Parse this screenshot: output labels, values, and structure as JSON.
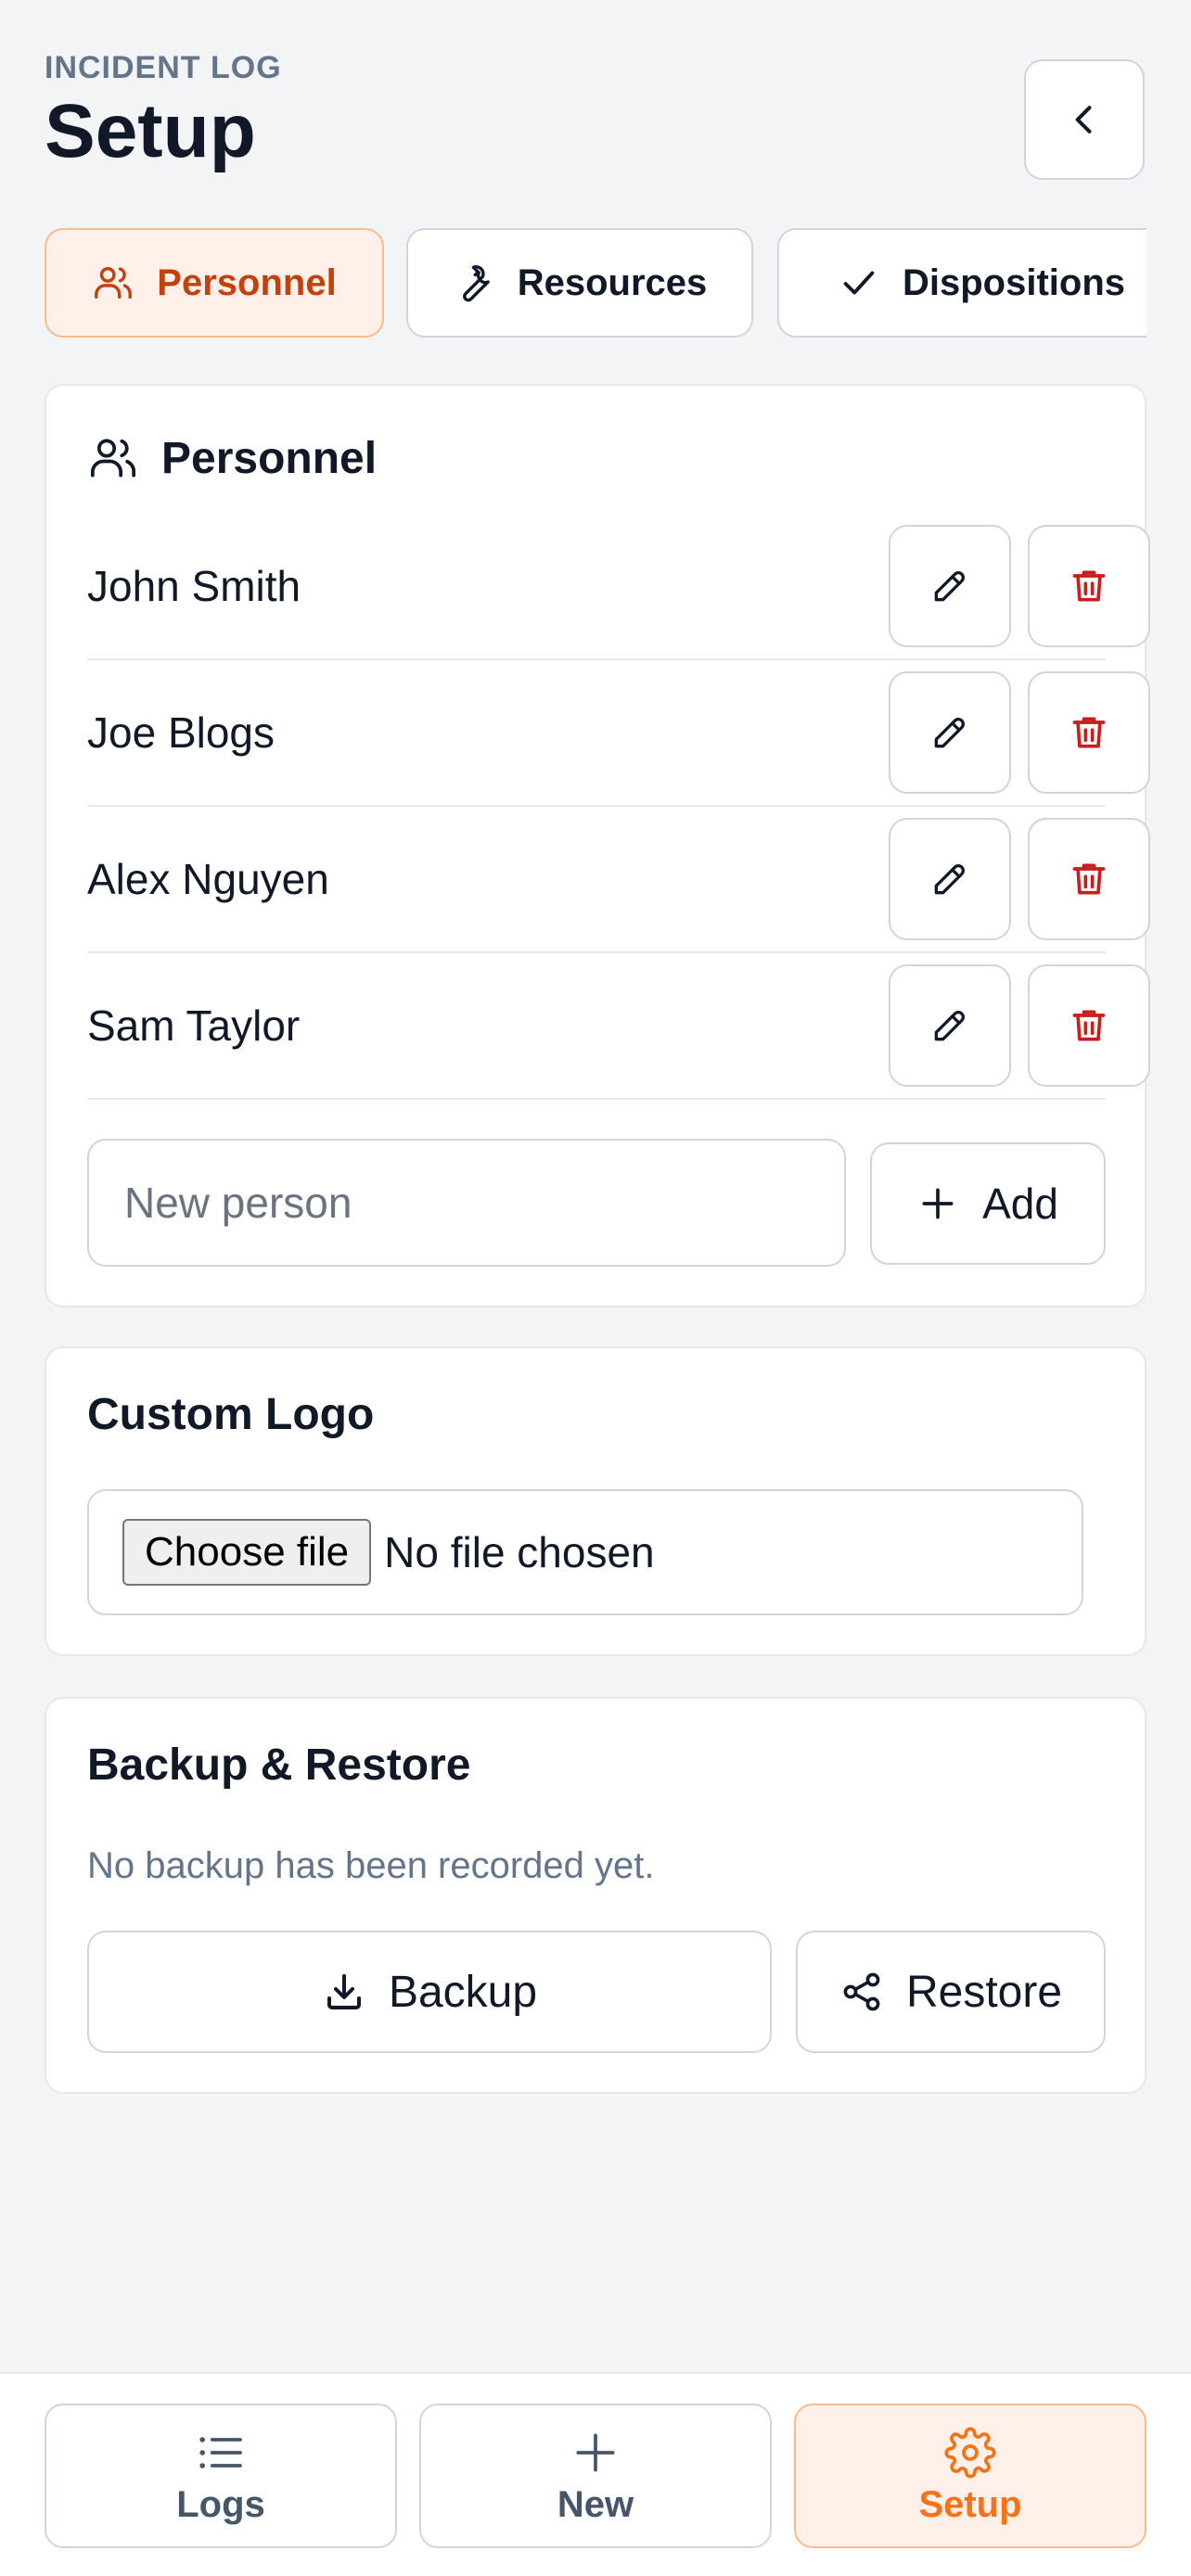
{
  "header": {
    "eyebrow": "INCIDENT LOG",
    "title": "Setup",
    "back_icon": "chevron-left-icon"
  },
  "tabs": [
    {
      "label": "Personnel",
      "icon": "users-icon",
      "active": true
    },
    {
      "label": "Resources",
      "icon": "wrench-icon",
      "active": false
    },
    {
      "label": "Dispositions",
      "icon": "check-icon",
      "active": false
    }
  ],
  "personnel": {
    "title": "Personnel",
    "people": [
      {
        "name": "John Smith"
      },
      {
        "name": "Joe Blogs"
      },
      {
        "name": "Alex Nguyen"
      },
      {
        "name": "Sam Taylor"
      }
    ],
    "new_placeholder": "New person",
    "add_label": "Add"
  },
  "logo": {
    "title": "Custom Logo",
    "choose_label": "Choose file",
    "file_status": "No file chosen"
  },
  "backup": {
    "title": "Backup & Restore",
    "status": "No backup has been recorded yet.",
    "backup_label": "Backup",
    "restore_label": "Restore"
  },
  "nav": [
    {
      "label": "Logs",
      "icon": "list-icon",
      "active": false
    },
    {
      "label": "New",
      "icon": "plus-icon",
      "active": false
    },
    {
      "label": "Setup",
      "icon": "gear-icon",
      "active": true
    }
  ],
  "colors": {
    "accent": "#f97316",
    "accent_bg": "#fff1ea",
    "danger": "#c81e1e",
    "muted": "#64748b"
  }
}
